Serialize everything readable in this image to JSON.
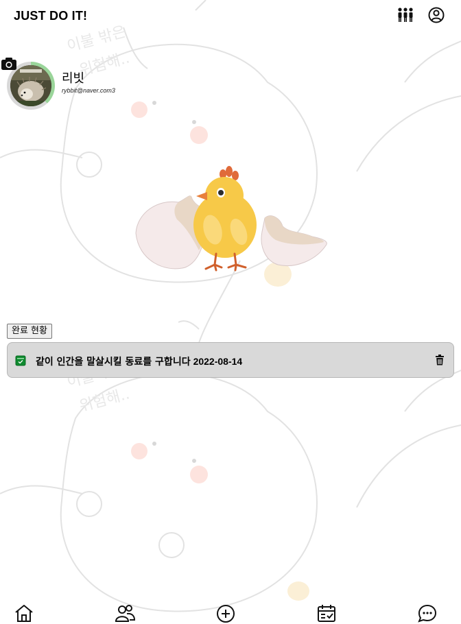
{
  "header": {
    "app_title": "JUST DO IT!",
    "icons": [
      "team-icon",
      "user-circle-icon"
    ]
  },
  "profile": {
    "name": "리빗",
    "email": "rybbit@naver.com3",
    "progress": 0.38,
    "icons": [
      "camera-icon"
    ]
  },
  "background_text": "이불 밖은 위험해..",
  "main": {
    "status_button_label": "완료 현황"
  },
  "todos": [
    {
      "text": "같이 인간을 말살시킬 동료를 구합니다",
      "date": "2022-08-14",
      "icons": [
        "checkbox-icon",
        "trash-icon"
      ]
    }
  ],
  "bottom_nav": {
    "items": [
      "home-icon",
      "friends-icon",
      "add-icon",
      "calendar-check-icon",
      "chat-icon"
    ]
  },
  "colors": {
    "todo_bg": "#d9d9d9",
    "check_green": "#0f8a2f",
    "progress_green": "#9ad59a",
    "chick_yellow": "#f7c948"
  }
}
